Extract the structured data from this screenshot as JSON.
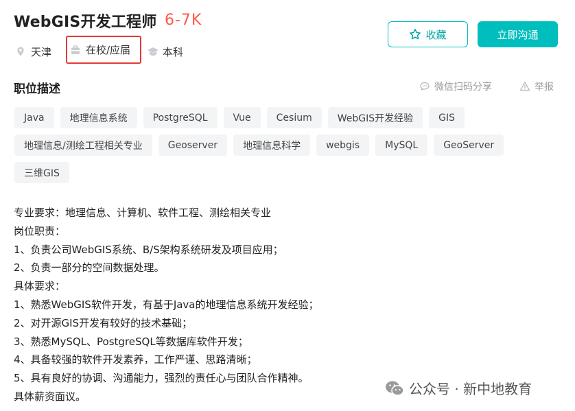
{
  "job": {
    "title": "WebGIS开发工程师",
    "salary": "6-7K",
    "city": "天津",
    "experience": "在校/应届",
    "education": "本科"
  },
  "actions": {
    "collect_label": "收藏",
    "chat_label": "立即沟通"
  },
  "section": {
    "title": "职位描述",
    "share_label": "微信扫码分享",
    "report_label": "举报"
  },
  "tags": [
    "Java",
    "地理信息系统",
    "PostgreSQL",
    "Vue",
    "Cesium",
    "WebGIS开发经验",
    "GIS",
    "地理信息/测绘工程相关专业",
    "Geoserver",
    "地理信息科学",
    "webgis",
    "MySQL",
    "GeoServer",
    "三维GIS"
  ],
  "description": [
    "专业要求：地理信息、计算机、软件工程、测绘相关专业",
    "岗位职责：",
    "1、负责公司WebGIS系统、B/S架构系统研发及项目应用；",
    "2、负责一部分的空间数据处理。",
    "具体要求：",
    "1、熟悉WebGIS软件开发，有基于Java的地理信息系统开发经验；",
    "2、对开源GIS开发有较好的技术基础；",
    "3、熟悉MySQL、PostgreSQL等数据库软件开发；",
    "4、具备较强的软件开发素养，工作严谨、思路清晰；",
    "5、具有良好的协调、沟通能力，强烈的责任心与团队合作精神。",
    "具体薪资面议。"
  ],
  "watermark": {
    "text": "公众号 · 新中地教育"
  },
  "colors": {
    "accent": "#00bebd",
    "salary": "#fe574a",
    "highlight_box": "#e53935",
    "tag_bg": "#f3f4f6"
  },
  "icons": {
    "city": "location-pin-icon",
    "experience": "briefcase-icon",
    "education": "graduation-cap-icon",
    "collect": "star-icon",
    "share": "wechat-bubble-icon",
    "report": "warning-triangle-icon"
  }
}
